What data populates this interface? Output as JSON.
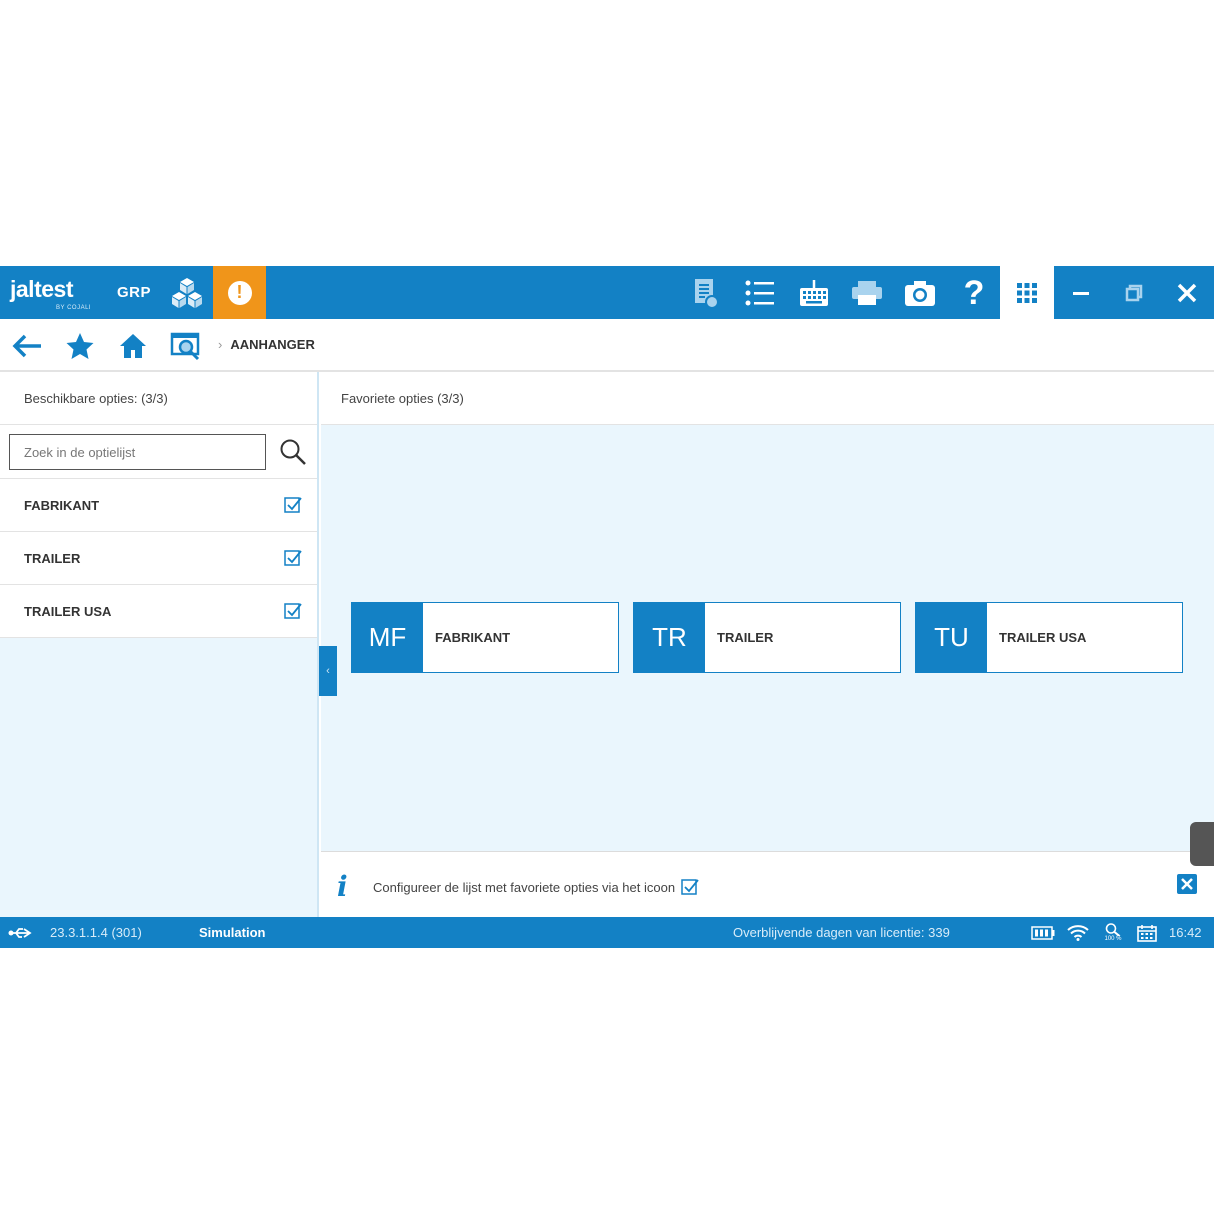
{
  "app": {
    "logo_text": "jaltest",
    "logo_by": "BY COJALI",
    "mode": "GRP"
  },
  "topbar": {
    "icons": [
      "document-icon",
      "list-icon",
      "keyboard-icon",
      "printer-icon",
      "camera-icon",
      "help-icon",
      "apps-grid-icon"
    ],
    "help_glyph": "?"
  },
  "navbar": {
    "breadcrumb": "AANHANGER"
  },
  "left_panel": {
    "header": "Beschikbare opties: (3/3)",
    "search_placeholder": "Zoek in de optielijst",
    "options": [
      {
        "label": "FABRIKANT",
        "checked": true
      },
      {
        "label": "TRAILER",
        "checked": true
      },
      {
        "label": "TRAILER USA",
        "checked": true
      }
    ]
  },
  "right_panel": {
    "header": "Favoriete opties (3/3)",
    "favorites": [
      {
        "abbr": "MF",
        "label": "FABRIKANT"
      },
      {
        "abbr": "TR",
        "label": "TRAILER"
      },
      {
        "abbr": "TU",
        "label": "TRAILER USA"
      }
    ],
    "info_text": "Configureer de lijst met favoriete opties via het icoon"
  },
  "statusbar": {
    "version": "23.3.1.1.4 (301)",
    "mode": "Simulation",
    "license": "Overblijvende dagen van licentie: 339",
    "zoom": "100 %",
    "time": "16:42"
  },
  "colors": {
    "primary": "#1381c5",
    "alert": "#f0951a",
    "panel_bg": "#eaf6fd"
  }
}
